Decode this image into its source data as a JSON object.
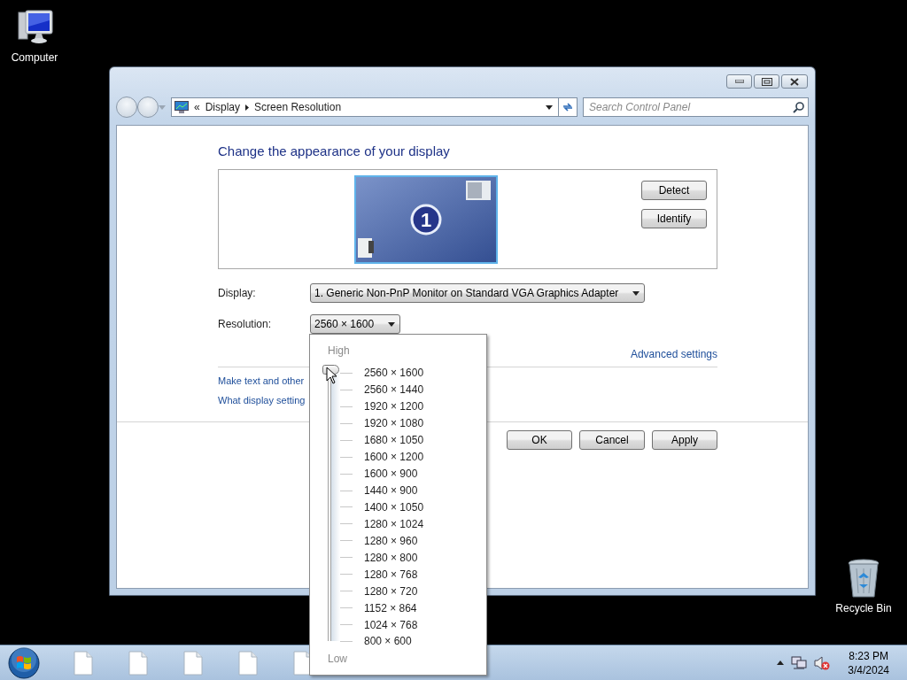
{
  "desktop_icons": [
    {
      "kind": "computer",
      "label": "Computer"
    },
    {
      "kind": "recycle-bin",
      "label": "Recycle Bin"
    }
  ],
  "window": {
    "address_bar": {
      "overflow": "«",
      "crumbs": [
        "Display",
        "Screen Resolution"
      ]
    },
    "search": {
      "placeholder": "Search Control Panel"
    },
    "heading": "Change the appearance of your display",
    "monitor": {
      "number": "1"
    },
    "side_buttons": [
      "Detect",
      "Identify"
    ],
    "display": {
      "label": "Display:",
      "value": "1. Generic Non-PnP Monitor on Standard VGA Graphics Adapter"
    },
    "resolution": {
      "label": "Resolution:",
      "value": "2560 × 1600"
    },
    "advanced_link": "Advanced settings",
    "links": [
      "Make text and other",
      "What display setting"
    ],
    "buttons": [
      "OK",
      "Cancel",
      "Apply"
    ]
  },
  "resolution_popup": {
    "high_label": "High",
    "low_label": "Low",
    "level": 1,
    "options": [
      "2560 × 1600",
      "2560 × 1440",
      "1920 × 1200",
      "1920 × 1080",
      "1680 × 1050",
      "1600 × 1200",
      "1600 × 900",
      "1440 × 900",
      "1400 × 1050",
      "1280 × 1024",
      "1280 × 960",
      "1280 × 800",
      "1280 × 768",
      "1280 × 720",
      "1152 × 864",
      "1024 × 768",
      "800 × 600"
    ]
  },
  "taskbar": {
    "buttons": [
      {
        "kind": "document"
      },
      {
        "kind": "document"
      },
      {
        "kind": "document"
      },
      {
        "kind": "document"
      },
      {
        "kind": "document"
      }
    ],
    "clock": {
      "time": "8:23 PM",
      "date": "3/4/2024"
    }
  }
}
